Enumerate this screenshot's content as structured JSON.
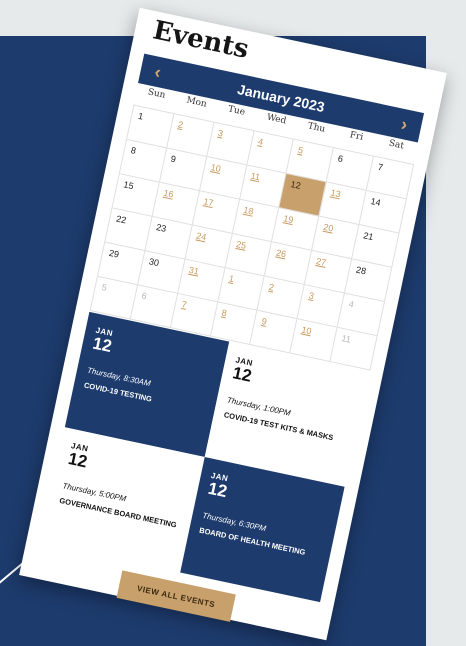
{
  "page": {
    "title": "Events",
    "view_all_label": "VIEW ALL EVENTS"
  },
  "calendar": {
    "month_label": "January 2023",
    "prev_icon": "‹",
    "next_icon": "›",
    "weekdays": [
      "Sun",
      "Mon",
      "Tue",
      "Wed",
      "Thu",
      "Fri",
      "Sat"
    ],
    "days": [
      {
        "label": "1",
        "type": "plain"
      },
      {
        "label": "2",
        "type": "event"
      },
      {
        "label": "3",
        "type": "event"
      },
      {
        "label": "4",
        "type": "event"
      },
      {
        "label": "5",
        "type": "event"
      },
      {
        "label": "6",
        "type": "plain"
      },
      {
        "label": "7",
        "type": "plain"
      },
      {
        "label": "8",
        "type": "plain"
      },
      {
        "label": "9",
        "type": "plain"
      },
      {
        "label": "10",
        "type": "event"
      },
      {
        "label": "11",
        "type": "event"
      },
      {
        "label": "12",
        "type": "today"
      },
      {
        "label": "13",
        "type": "event"
      },
      {
        "label": "14",
        "type": "plain"
      },
      {
        "label": "15",
        "type": "plain"
      },
      {
        "label": "16",
        "type": "event"
      },
      {
        "label": "17",
        "type": "event"
      },
      {
        "label": "18",
        "type": "event"
      },
      {
        "label": "19",
        "type": "event"
      },
      {
        "label": "20",
        "type": "event"
      },
      {
        "label": "21",
        "type": "plain"
      },
      {
        "label": "22",
        "type": "plain"
      },
      {
        "label": "23",
        "type": "plain"
      },
      {
        "label": "24",
        "type": "event"
      },
      {
        "label": "25",
        "type": "event"
      },
      {
        "label": "26",
        "type": "event"
      },
      {
        "label": "27",
        "type": "event"
      },
      {
        "label": "28",
        "type": "plain"
      },
      {
        "label": "29",
        "type": "plain"
      },
      {
        "label": "30",
        "type": "plain"
      },
      {
        "label": "31",
        "type": "event"
      },
      {
        "label": "1",
        "type": "event-muted"
      },
      {
        "label": "2",
        "type": "event-muted"
      },
      {
        "label": "3",
        "type": "event-muted"
      },
      {
        "label": "4",
        "type": "muted"
      },
      {
        "label": "5",
        "type": "muted"
      },
      {
        "label": "6",
        "type": "muted"
      },
      {
        "label": "7",
        "type": "event-muted"
      },
      {
        "label": "8",
        "type": "event-muted"
      },
      {
        "label": "9",
        "type": "event-muted"
      },
      {
        "label": "10",
        "type": "event-muted"
      },
      {
        "label": "11",
        "type": "muted"
      }
    ]
  },
  "events": [
    {
      "month": "JAN",
      "day": "12",
      "time": "Thursday, 8:30AM",
      "name": "COVID-19 TESTING",
      "style": "dark"
    },
    {
      "month": "JAN",
      "day": "12",
      "time": "Thursday, 1:00PM",
      "name": "COVID-19 TEST KITS & MASKS",
      "style": "light"
    },
    {
      "month": "JAN",
      "day": "12",
      "time": "Thursday, 5:00PM",
      "name": "GOVERNANCE BOARD MEETING",
      "style": "light"
    },
    {
      "month": "JAN",
      "day": "12",
      "time": "Thursday, 6:30PM",
      "name": "BOARD OF HEALTH MEETING",
      "style": "dark"
    }
  ],
  "colors": {
    "navy": "#1d3b6d",
    "gold": "#c8a06b",
    "background": "#e6eaea"
  }
}
